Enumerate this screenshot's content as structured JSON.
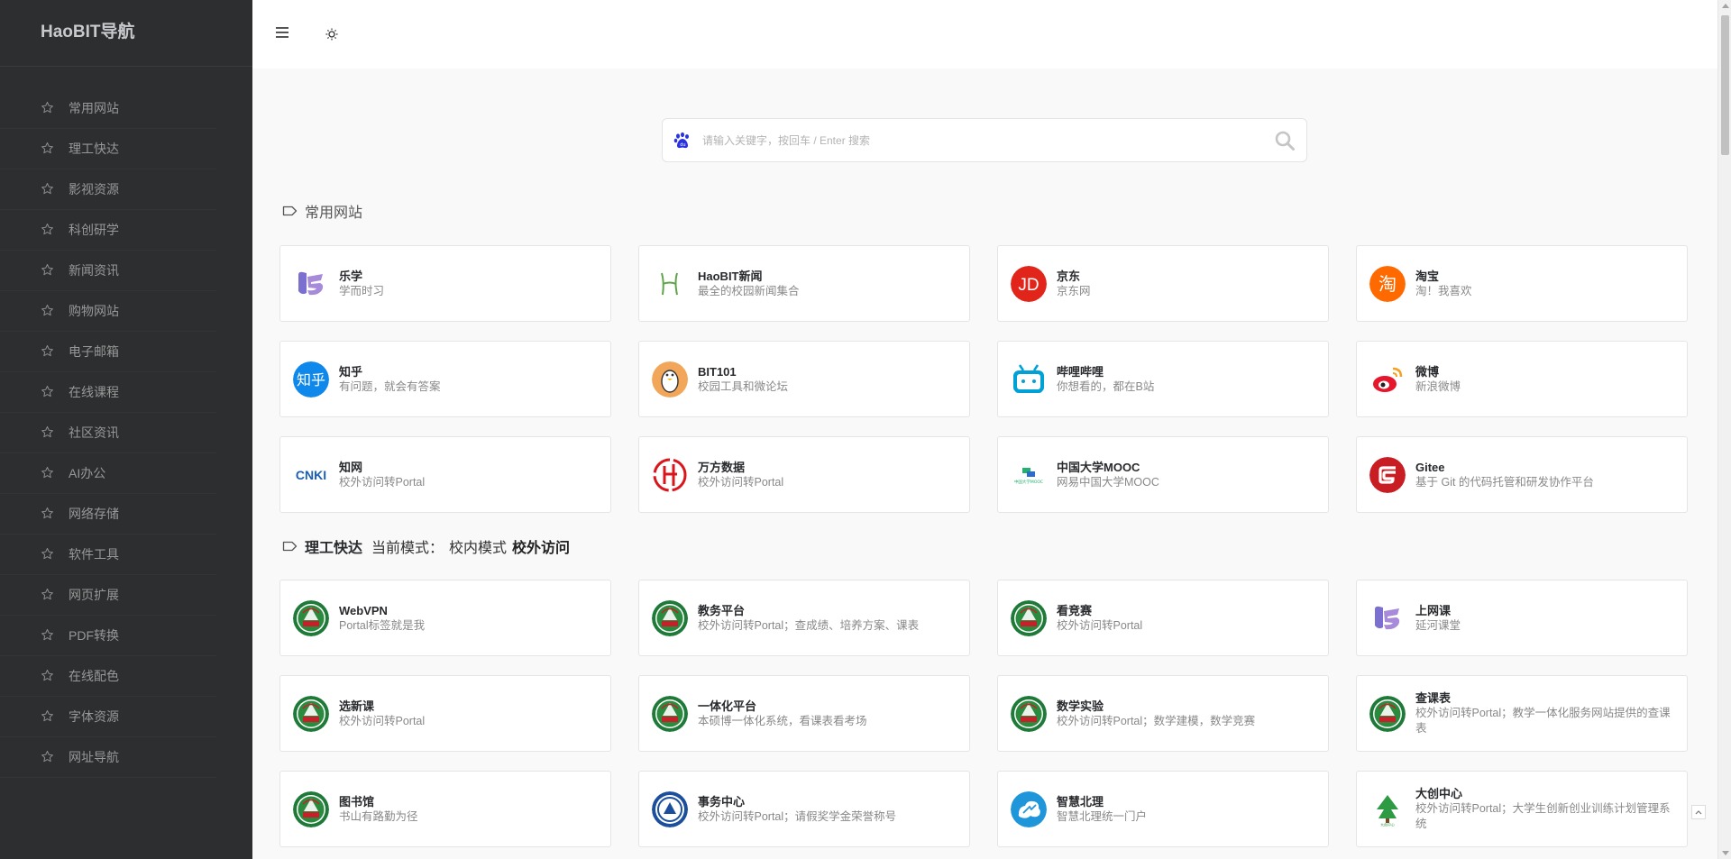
{
  "brand": "HaoBIT导航",
  "sidebar": {
    "items": [
      {
        "label": "常用网站"
      },
      {
        "label": "理工快达"
      },
      {
        "label": "影视资源"
      },
      {
        "label": "科创研学"
      },
      {
        "label": "新闻资讯"
      },
      {
        "label": "购物网站"
      },
      {
        "label": "电子邮箱"
      },
      {
        "label": "在线课程"
      },
      {
        "label": "社区资讯"
      },
      {
        "label": "AI办公"
      },
      {
        "label": "网络存储"
      },
      {
        "label": "软件工具"
      },
      {
        "label": "网页扩展"
      },
      {
        "label": "PDF转换"
      },
      {
        "label": "在线配色"
      },
      {
        "label": "字体资源"
      },
      {
        "label": "网址导航"
      }
    ]
  },
  "search": {
    "placeholder": "请输入关键字，按回车 / Enter 搜索"
  },
  "sections": {
    "common": {
      "title": "常用网站"
    },
    "bit": {
      "title": "理工快达",
      "mode_label": "当前模式：",
      "mode_inner": "校内模式",
      "mode_outer": "校外访问"
    }
  },
  "common_cards": [
    {
      "title": "乐学",
      "desc": "学而时习",
      "icon": "lexue-icon"
    },
    {
      "title": "HaoBIT新闻",
      "desc": "最全的校园新闻集合",
      "icon": "haobit-news-icon"
    },
    {
      "title": "京东",
      "desc": "京东网",
      "icon": "jd-icon"
    },
    {
      "title": "淘宝",
      "desc": "淘！我喜欢",
      "icon": "taobao-icon"
    },
    {
      "title": "知乎",
      "desc": "有问题，就会有答案",
      "icon": "zhihu-icon"
    },
    {
      "title": "BIT101",
      "desc": "校园工具和微论坛",
      "icon": "bit101-icon"
    },
    {
      "title": "哔哩哔哩",
      "desc": "你想看的，都在B站",
      "icon": "bilibili-icon"
    },
    {
      "title": "微博",
      "desc": "新浪微博",
      "icon": "weibo-icon"
    },
    {
      "title": "知网",
      "desc": "校外访问转Portal",
      "icon": "cnki-icon"
    },
    {
      "title": "万方数据",
      "desc": "校外访问转Portal",
      "icon": "wanfang-icon"
    },
    {
      "title": "中国大学MOOC",
      "desc": "网易中国大学MOOC",
      "icon": "mooc-icon"
    },
    {
      "title": "Gitee",
      "desc": "基于 Git 的代码托管和研发协作平台",
      "icon": "gitee-icon"
    }
  ],
  "bit_cards": [
    {
      "title": "WebVPN",
      "desc": "Portal标签就是我",
      "icon": "bit-emblem-icon"
    },
    {
      "title": "教务平台",
      "desc": "校外访问转Portal；查成绩、培养方案、课表",
      "icon": "bit-emblem-icon"
    },
    {
      "title": "看竞赛",
      "desc": "校外访问转Portal",
      "icon": "bit-emblem-icon"
    },
    {
      "title": "上网课",
      "desc": "延河课堂",
      "icon": "lexue-icon"
    },
    {
      "title": "选新课",
      "desc": "校外访问转Portal",
      "icon": "bit-emblem-icon"
    },
    {
      "title": "一体化平台",
      "desc": "本硕博一体化系统，看课表看考场",
      "icon": "bit-emblem-icon"
    },
    {
      "title": "数学实验",
      "desc": "校外访问转Portal；数学建模，数学竞赛",
      "icon": "bit-emblem-icon"
    },
    {
      "title": "查课表",
      "desc": "校外访问转Portal；教学一体化服务网站提供的查课表",
      "icon": "bit-emblem-icon"
    },
    {
      "title": "图书馆",
      "desc": "书山有路勤为径",
      "icon": "bit-emblem-icon"
    },
    {
      "title": "事务中心",
      "desc": "校外访问转Portal；请假奖学金荣誉称号",
      "icon": "bit-service-icon"
    },
    {
      "title": "智慧北理",
      "desc": "智慧北理统一门户",
      "icon": "smart-bit-icon"
    },
    {
      "title": "大创中心",
      "desc": "校外访问转Portal；大学生创新创业训练计划管理系统",
      "icon": "dachuang-icon"
    }
  ]
}
